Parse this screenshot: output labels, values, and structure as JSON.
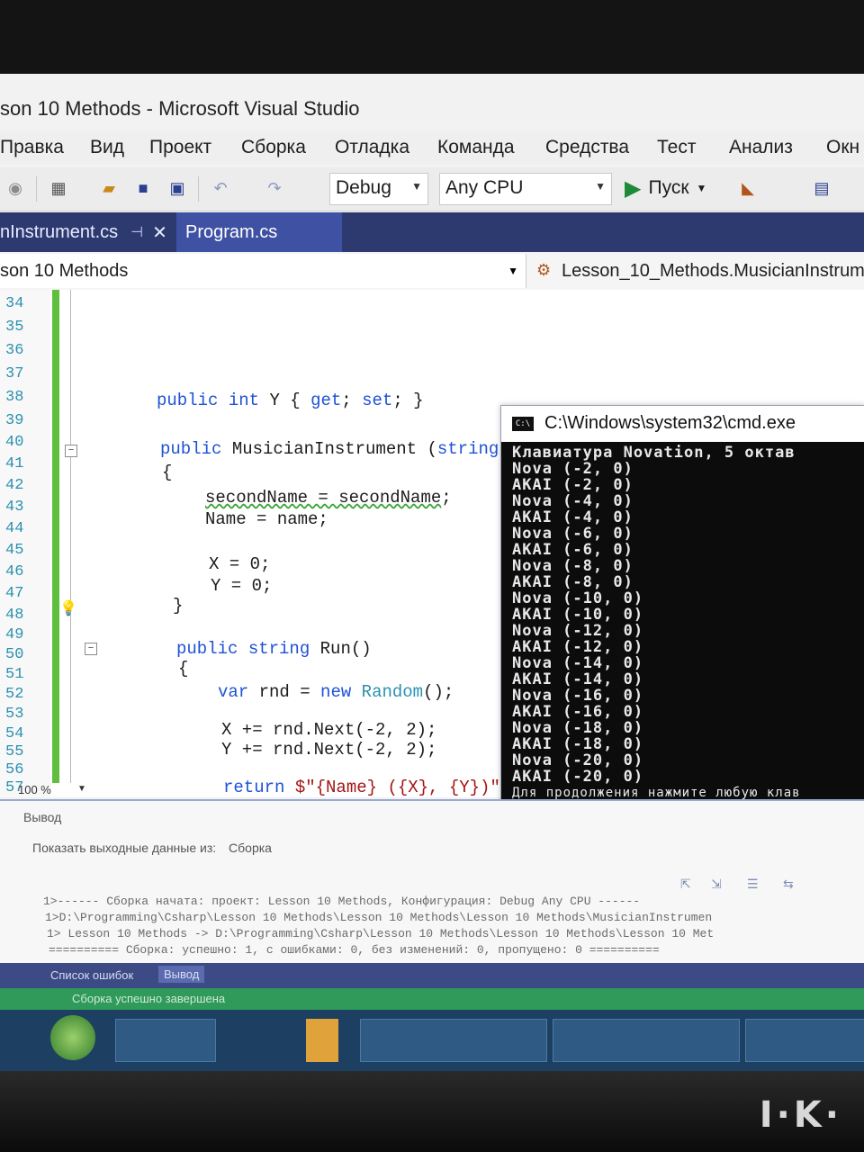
{
  "window": {
    "title": "son 10 Methods - Microsoft Visual Studio"
  },
  "menu": [
    "Правка",
    "Вид",
    "Проект",
    "Сборка",
    "Отладка",
    "Команда",
    "Средства",
    "Тест",
    "Анализ",
    "Окн"
  ],
  "toolbar": {
    "config": "Debug",
    "platform": "Any CPU",
    "start_label": "Пуск"
  },
  "tabs": {
    "musician": "nInstrument.cs",
    "program": "Program.cs"
  },
  "navbar": {
    "project": "son 10 Methods",
    "type": "Lesson_10_Methods.MusicianInstrum"
  },
  "editor": {
    "line_numbers": [
      "34",
      "35",
      "36",
      "37",
      "38",
      "39",
      "40",
      "41",
      "42",
      "43",
      "44",
      "45",
      "46",
      "47",
      "48",
      "49",
      "50",
      "51",
      "52",
      "53",
      "54",
      "55",
      "56",
      "57"
    ],
    "zoom": "100 %"
  },
  "console": {
    "title": "C:\\Windows\\system32\\cmd.exe",
    "lines": [
      "Клавиатура Novation, 5 октав",
      "Nova (-2, 0)",
      "AKAI (-2, 0)",
      "Nova (-4, 0)",
      "AKAI (-4, 0)",
      "Nova (-6, 0)",
      "AKAI (-6, 0)",
      "Nova (-8, 0)",
      "AKAI (-8, 0)",
      "Nova (-10, 0)",
      "AKAI (-10, 0)",
      "Nova (-12, 0)",
      "AKAI (-12, 0)",
      "Nova (-14, 0)",
      "AKAI (-14, 0)",
      "Nova (-16, 0)",
      "AKAI (-16, 0)",
      "Nova (-18, 0)",
      "AKAI (-18, 0)",
      "Nova (-20, 0)",
      "AKAI (-20, 0)",
      "Для продолжения нажмите любую клав"
    ]
  },
  "output": {
    "title": "Вывод",
    "show_from_label": "Показать выходные данные из:",
    "show_from_value": "Сборка",
    "lines": [
      "1>------ Сборка начата: проект: Lesson 10 Methods, Конфигурация: Debug Any CPU ------",
      "1>D:\\Programming\\Csharp\\Lesson 10 Methods\\Lesson 10 Methods\\Lesson 10 Methods\\MusicianInstrumen",
      "1>  Lesson 10 Methods -> D:\\Programming\\Csharp\\Lesson 10 Methods\\Lesson 10 Methods\\Lesson 10 Met",
      "========== Сборка: успешно: 1, с ошибками: 0, без изменений: 0, пропущено: 0 =========="
    ]
  },
  "bottom_tabs": {
    "errors": "Список ошибок",
    "output": "Вывод"
  },
  "status": {
    "text": "Сборка успешно завершена"
  }
}
